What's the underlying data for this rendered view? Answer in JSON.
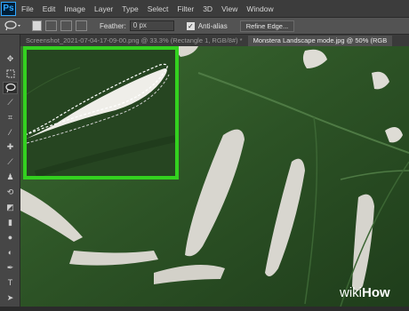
{
  "menubar": {
    "logo": "Ps",
    "items": [
      "File",
      "Edit",
      "Image",
      "Layer",
      "Type",
      "Select",
      "Filter",
      "3D",
      "View",
      "Window"
    ]
  },
  "options": {
    "feather_label": "Feather:",
    "feather_value": "0 px",
    "antialias_label": "Anti-alias",
    "antialias_checked": true,
    "refine_label": "Refine Edge..."
  },
  "tabs": [
    {
      "label": "Screenshot_2021-07-04-17-09-00.png @ 33.3% (Rectangle 1, RGB/8#) *",
      "active": false
    },
    {
      "label": "Monstera Landscape mode.jpg @ 50% (RGB",
      "active": true
    }
  ],
  "tools": [
    "move-icon",
    "marquee-icon",
    "lasso-icon",
    "quick-select-icon",
    "crop-icon",
    "eyedropper-icon",
    "healing-icon",
    "brush-icon",
    "stamp-icon",
    "history-brush-icon",
    "eraser-icon",
    "gradient-icon",
    "blur-icon",
    "dodge-icon",
    "pen-icon",
    "type-icon",
    "path-select-icon"
  ],
  "watermark": {
    "wiki": "wiki",
    "how": "How"
  },
  "colors": {
    "highlight": "#33d11f",
    "leaf": "#2e5527",
    "background_light": "#dcdad3"
  }
}
